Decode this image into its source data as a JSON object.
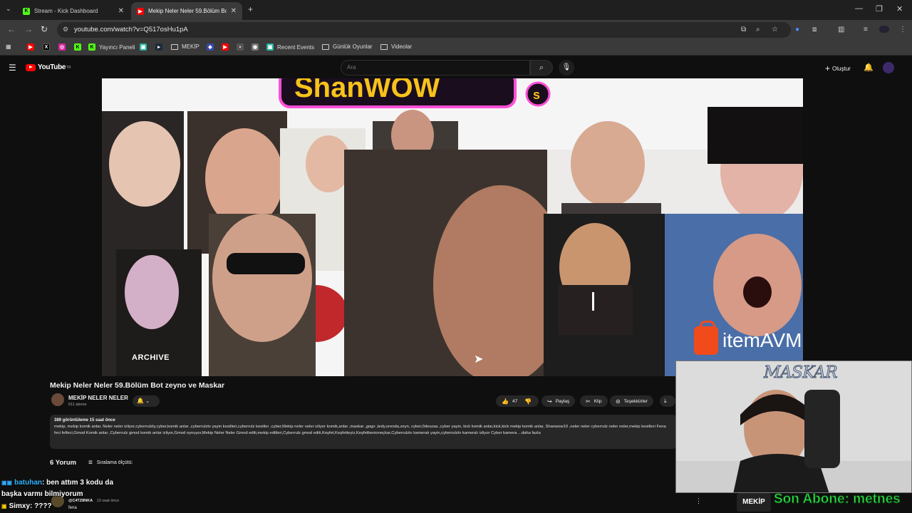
{
  "browser": {
    "tabs": [
      {
        "title": "Stream - Kick Dashboard",
        "active": false,
        "icon": "kick-icon"
      },
      {
        "title": "Mekip Neler Neler 59.Bölüm Bo",
        "active": true,
        "icon": "youtube-icon"
      }
    ],
    "url": "youtube.com/watch?v=Q517osHu1pA",
    "bookmarks": [
      "Yayıncı Paneli",
      "MEKİP",
      "Recent Events",
      "Günlük Oyunlar",
      "Videolar"
    ]
  },
  "youtube": {
    "logo_text": "YouTube",
    "region": "TR",
    "search_placeholder": "Ara",
    "create_label": "Oluştur"
  },
  "video": {
    "title": "Mekip Neler Neler 59.Bölüm Bot zeyno ve Maskar",
    "thumbnail_text": "ARCHIVE",
    "channel": {
      "name": "MEKİP NELER NELER",
      "subscribers": "611 abone"
    },
    "likes": "47",
    "actions": [
      "Paylaş",
      "Klip",
      "Teşekkürler"
    ],
    "description": {
      "meta": "389 görüntüleme  15 saat önce",
      "text": "mekip, mekip komik anlar, Neler neler izliyor,cyberrulzty,cyber,komik anlar ,cyberrulztv yayin kesitleri,cyberrulz kesitler ,cyber,Mekip neler neler izliyor komik,anlar ,maskar ,gogo ,tedy,orenda,zeyn, cyber,0deszaa ,cyber yayin, kick komik anlar,kick,kick mekip komik anlar, Shanwow10 ,neler neler cyberrulz neler neler,mekip kesitleri Fena feci felfeci,Gmod Komik anlar ,Cyberrulz gmod komik anlar izliyor,Gmod oynuyor,Mekip Neler Neler Gmod editi,mekip editleri,Cyberrulz gmod editi,Keşfet,Keşfetteyiz,Keşfetbenioneçkar,Cyberrulztv kameralı yayin,cyberrulztv kameralı izliyor Cyber kamera ...daha fazla"
    },
    "comments_count": "6 Yorum",
    "sort_label": "Sıralama ölçütü:"
  },
  "overlays": {
    "sponsor": "itemAVM",
    "webcam_name": "MASKAR",
    "sub_alert": "Son Abone: metnes",
    "badge": "MEKİP"
  },
  "chat": [
    {
      "user": "batuhan",
      "message": ": ben attım 3 kodu da"
    },
    {
      "user": "",
      "message": "başka varmı bilmiyorum"
    },
    {
      "user": "Simxy",
      "message": ": ????"
    }
  ],
  "comment_preview": {
    "user": "@C4TZ8NKA",
    "time": "13 saat önce",
    "text": "fena"
  }
}
